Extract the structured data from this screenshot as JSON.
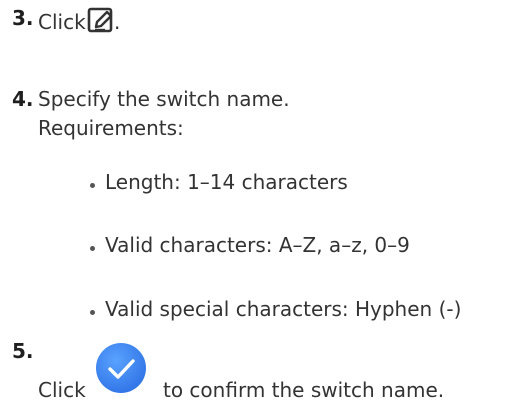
{
  "steps": [
    {
      "number": "3.",
      "text_before": "Click",
      "icon": "edit-icon",
      "text_after": "."
    },
    {
      "number": "4.",
      "line1": "Specify the switch name.",
      "line2": "Requirements:",
      "requirements": [
        "Length: 1–14 characters",
        "Valid characters: A–Z, a–z, 0–9",
        "Valid special characters: Hyphen (-)"
      ]
    },
    {
      "number": "5.",
      "text_before": "Click",
      "icon": "check-circle-icon",
      "text_after": "to confirm the switch name."
    }
  ],
  "colors": {
    "confirm_icon_fill": "#3b82f6",
    "text": "#333333"
  }
}
